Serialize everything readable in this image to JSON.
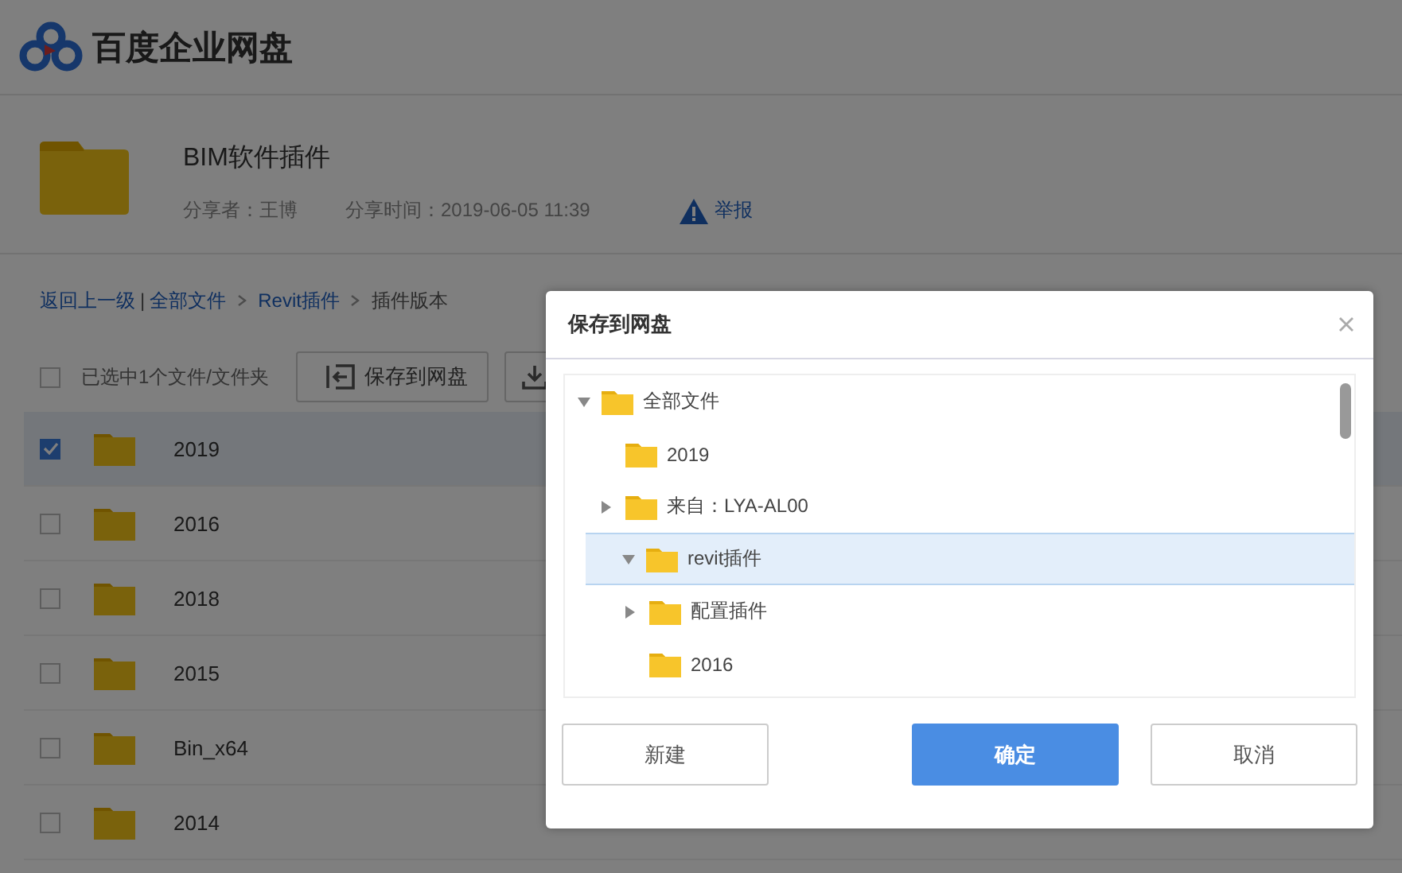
{
  "header": {
    "brand": "百度企业网盘"
  },
  "share": {
    "title": "BIM软件插件",
    "sharer": "分享者：王博",
    "time": "分享时间：2019-06-05 11:39",
    "report": "举报"
  },
  "breadcrumb": {
    "back": "返回上一级",
    "separator": "|",
    "path": [
      {
        "label": "全部文件",
        "kind": "link"
      },
      {
        "label": "Revit插件",
        "kind": "link"
      },
      {
        "label": "插件版本",
        "kind": "current"
      }
    ]
  },
  "toolbar": {
    "select_all": {
      "checked": false,
      "label": "已选中1个文件/文件夹"
    },
    "save_button": "保存到网盘"
  },
  "files": [
    {
      "name": "2019",
      "checked": true
    },
    {
      "name": "2016",
      "checked": false
    },
    {
      "name": "2018",
      "checked": false
    },
    {
      "name": "2015",
      "checked": false
    },
    {
      "name": "Bin_x64",
      "checked": false
    },
    {
      "name": "2014",
      "checked": false
    }
  ],
  "dialog": {
    "title": "保存到网盘",
    "tree": [
      {
        "label": "全部文件",
        "kind": "branch",
        "expanded": true,
        "selected": false,
        "children": [
          {
            "label": "2019",
            "kind": "leaf",
            "selected": false
          },
          {
            "label": "来自：LYA-AL00",
            "kind": "branch",
            "expanded": false,
            "selected": false
          },
          {
            "label": "revit插件",
            "kind": "branch",
            "expanded": true,
            "selected": true,
            "children": [
              {
                "label": "配置插件",
                "kind": "branch",
                "expanded": false,
                "selected": false
              },
              {
                "label": "2016",
                "kind": "leaf",
                "selected": false
              }
            ]
          }
        ]
      }
    ],
    "buttons": [
      {
        "label": "新建",
        "kind": "secondary"
      },
      {
        "label": "确定",
        "kind": "primary"
      },
      {
        "label": "取消",
        "kind": "secondary"
      }
    ]
  }
}
